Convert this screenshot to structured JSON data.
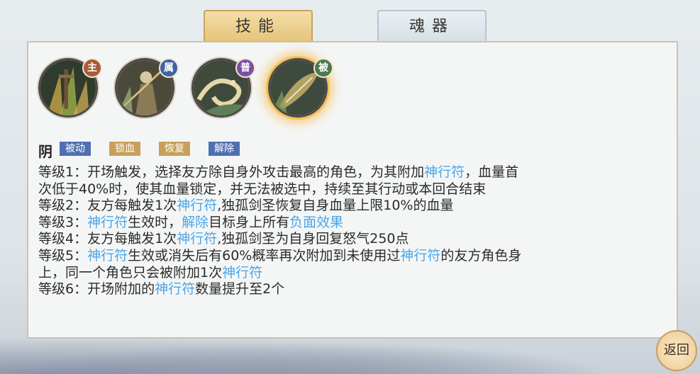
{
  "tabs": [
    {
      "label": "技能",
      "active": true
    },
    {
      "label": "魂器",
      "active": false
    }
  ],
  "skills": [
    {
      "badge": "主",
      "badge_color": "#a85a3a",
      "icon": "sword-grass-icon"
    },
    {
      "badge": "属",
      "badge_color": "#3f62a8",
      "icon": "swordsman-icon"
    },
    {
      "badge": "普",
      "badge_color": "#7a4fa6",
      "icon": "dragon-wave-icon"
    },
    {
      "badge": "被",
      "badge_color": "#4a7b4a",
      "icon": "talisman-leaf-icon",
      "selected": true
    }
  ],
  "selected_skill": {
    "name": "阴",
    "tags": [
      {
        "label": "被动",
        "color": "#4f6fb0"
      },
      {
        "label": "锁血",
        "color": "#c8a05a"
      },
      {
        "label": "恢复",
        "color": "#c8a05a"
      },
      {
        "label": "解除",
        "color": "#4f6fb0"
      }
    ],
    "lines": [
      [
        {
          "t": "等级1：开场触发，选择友方除自身外攻击最高的角色，为其附加"
        },
        {
          "t": "神行符",
          "kw": true
        },
        {
          "t": "，血量首"
        }
      ],
      [
        {
          "t": "次低于40%时，使其血量锁定，并无法被选中，持续至其行动或本回合结束"
        }
      ],
      [
        {
          "t": "等级2：友方每触发1次"
        },
        {
          "t": "神行符",
          "kw": true
        },
        {
          "t": ",独孤剑圣恢复自身血量上限10%的血量"
        }
      ],
      [
        {
          "t": "等级3："
        },
        {
          "t": "神行符",
          "kw": true
        },
        {
          "t": "生效时，"
        },
        {
          "t": "解除",
          "kw": true
        },
        {
          "t": "目标身上所有"
        },
        {
          "t": "负面效果",
          "kw": true
        }
      ],
      [
        {
          "t": "等级4：友方每触发1次"
        },
        {
          "t": "神行符",
          "kw": true
        },
        {
          "t": ",独孤剑圣为自身回复怒气250点"
        }
      ],
      [
        {
          "t": "等级5："
        },
        {
          "t": "神行符",
          "kw": true
        },
        {
          "t": "生效或消失后有60%概率再次附加到未使用过"
        },
        {
          "t": "神行符",
          "kw": true
        },
        {
          "t": "的友方角色身"
        }
      ],
      [
        {
          "t": "上，同一个角色只会被附加1次"
        },
        {
          "t": "神行符",
          "kw": true
        }
      ],
      [
        {
          "t": "等级6：开场附加的"
        },
        {
          "t": "神行符",
          "kw": true
        },
        {
          "t": "数量提升至2个"
        }
      ]
    ]
  },
  "back_label": "返回"
}
